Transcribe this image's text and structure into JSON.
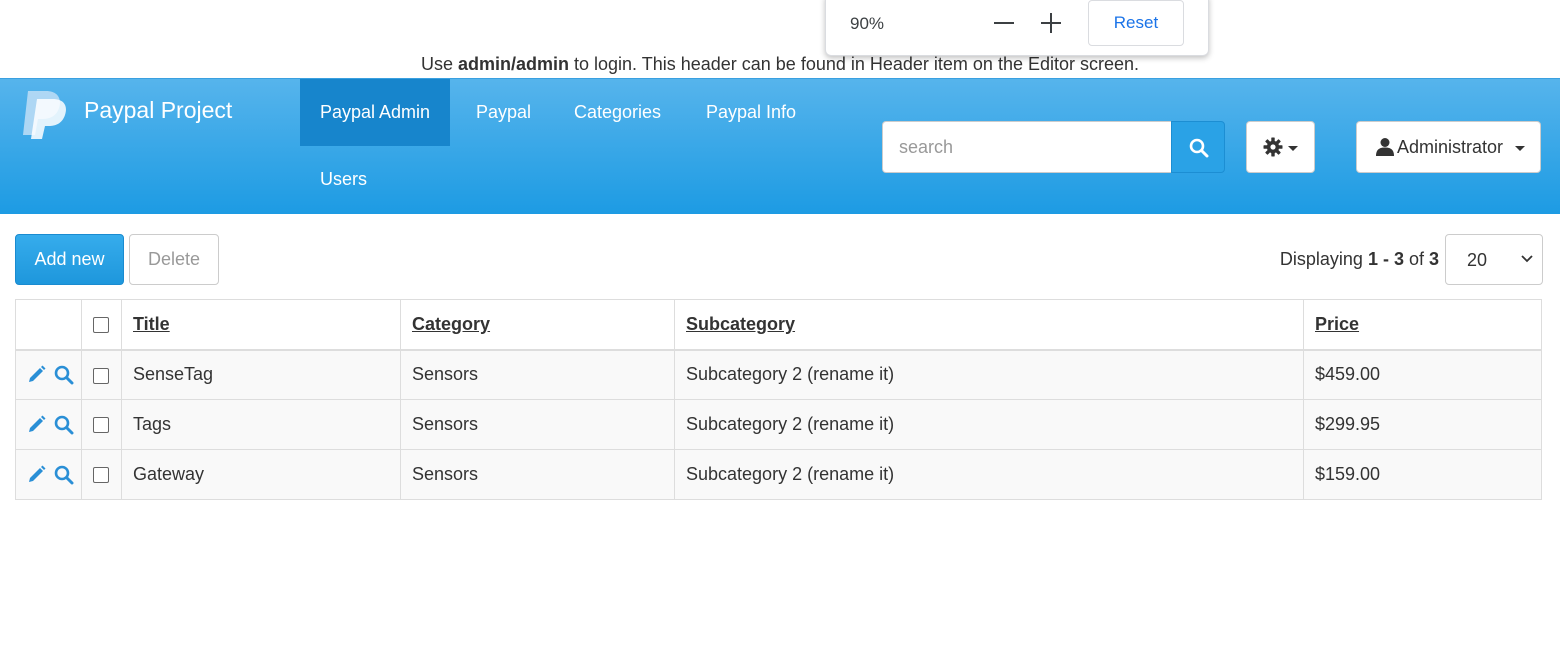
{
  "zoom_popup": {
    "level": "90%",
    "reset_label": "Reset",
    "icons": [
      "zoom-out-icon",
      "zoom-in-icon"
    ]
  },
  "top_note": {
    "prefix": "Use ",
    "credentials": "admin/admin",
    "suffix": " to login. This header can be found in Header item on the Editor screen."
  },
  "navbar": {
    "brand": "Paypal Project",
    "items": [
      {
        "label": "Paypal Admin",
        "active": true
      },
      {
        "label": "Paypal",
        "active": false
      },
      {
        "label": "Categories",
        "active": false
      },
      {
        "label": "Paypal Info",
        "active": false
      },
      {
        "label": "Users",
        "active": false
      }
    ],
    "search": {
      "placeholder": "search",
      "value": ""
    },
    "user_label": "Administrator",
    "colors": {
      "gradient_top": "#56b4ec",
      "gradient_bottom": "#1d9be3",
      "active_item": "#1785cc"
    }
  },
  "toolbar": {
    "add_label": "Add new",
    "delete_label": "Delete",
    "displaying_prefix": "Displaying ",
    "range_start": "1",
    "range_sep": " - ",
    "range_end": "3",
    "of_label": " of ",
    "total": "3",
    "page_size": "20"
  },
  "table": {
    "headers": [
      "Title",
      "Category",
      "Subcategory",
      "Price"
    ],
    "rows": [
      {
        "title": "SenseTag",
        "category": "Sensors",
        "subcategory": "Subcategory 2 (rename it)",
        "price": "$459.00"
      },
      {
        "title": "Tags",
        "category": "Sensors",
        "subcategory": "Subcategory 2 (rename it)",
        "price": "$299.95"
      },
      {
        "title": "Gateway",
        "category": "Sensors",
        "subcategory": "Subcategory 2 (rename it)",
        "price": "$159.00"
      }
    ]
  }
}
